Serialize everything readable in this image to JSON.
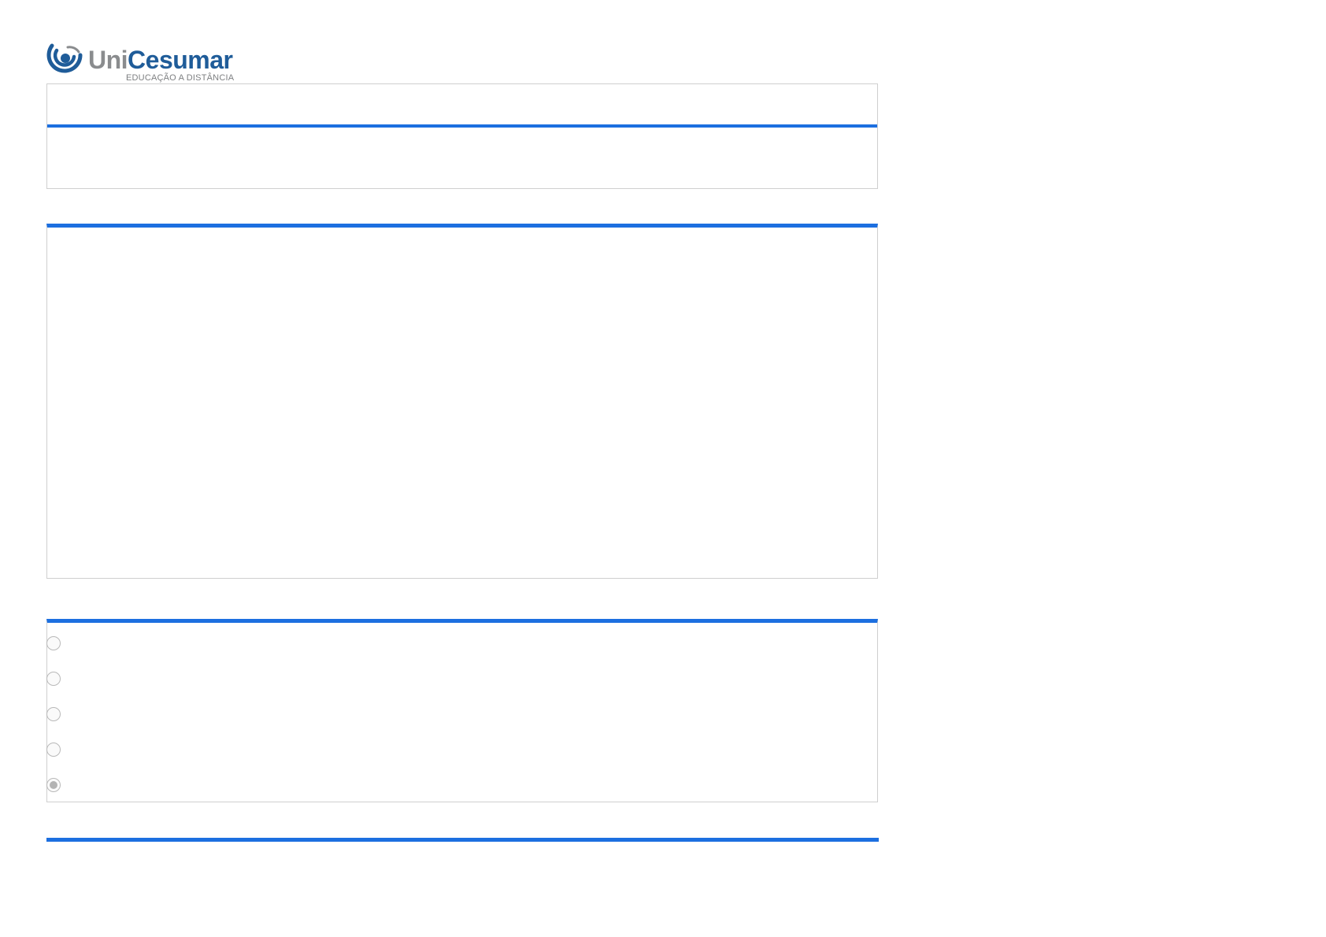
{
  "logo": {
    "word_uni": "Uni",
    "word_cesumar": "Cesumar",
    "subtitle": "EDUCAÇÃO A DISTÂNCIA",
    "icon": "unicesumar-logo-icon",
    "colors": {
      "gray": "#8a8c8e",
      "blue": "#1f5c99"
    }
  },
  "header_panel": {
    "title": "",
    "body": ""
  },
  "question_panel": {
    "text": ""
  },
  "answers": {
    "options": [
      {
        "label": "",
        "checked": false
      },
      {
        "label": "",
        "checked": false
      },
      {
        "label": "",
        "checked": false
      },
      {
        "label": "",
        "checked": false
      },
      {
        "label": "",
        "checked": true
      }
    ]
  },
  "colors": {
    "accent": "#1c6fe0",
    "border": "#cfcfcf"
  }
}
